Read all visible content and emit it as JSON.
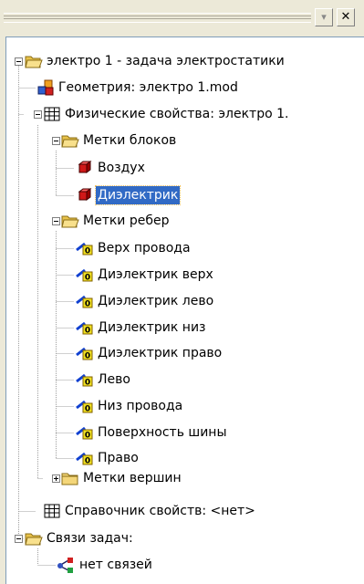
{
  "toolbar": {
    "dropdown_glyph": "▾",
    "close_glyph": "✕"
  },
  "colors": {
    "selection": "#316ac5",
    "folder": "#f4d679",
    "lines": "#a0a0a0"
  },
  "tree": {
    "root": {
      "label": "электро 1 - задача электростатики",
      "icon": "open-folder-icon"
    },
    "geometry": {
      "label": "Геометрия: электро 1.mod",
      "icon": "geometry-icon"
    },
    "props": {
      "label": "Физические свойства: электро 1.",
      "icon": "table-icon"
    },
    "block_labels": {
      "label": "Метки блоков",
      "icon": "open-folder-icon",
      "items": [
        {
          "label": "Воздух",
          "icon": "block-cube-icon"
        },
        {
          "label": "Диэлектрик",
          "icon": "block-cube-icon",
          "selected": true
        }
      ]
    },
    "edge_labels": {
      "label": "Метки ребер",
      "icon": "open-folder-icon",
      "items": [
        {
          "label": "Верх провода",
          "icon": "edge-icon"
        },
        {
          "label": "Диэлектрик верх",
          "icon": "edge-icon"
        },
        {
          "label": "Диэлектрик лево",
          "icon": "edge-icon"
        },
        {
          "label": "Диэлектрик низ",
          "icon": "edge-icon"
        },
        {
          "label": "Диэлектрик право",
          "icon": "edge-icon"
        },
        {
          "label": "Лево",
          "icon": "edge-icon"
        },
        {
          "label": "Низ провода",
          "icon": "edge-icon"
        },
        {
          "label": "Поверхность шины",
          "icon": "edge-icon"
        },
        {
          "label": "Право",
          "icon": "edge-icon"
        }
      ]
    },
    "vertex_labels": {
      "label": "Метки вершин",
      "icon": "closed-folder-icon"
    },
    "reference": {
      "label": "Справочник свойств: <нет>",
      "icon": "table-icon"
    },
    "links": {
      "label": "Связи задач:",
      "icon": "open-folder-icon",
      "items": [
        {
          "label": "нет связей",
          "icon": "link-icon"
        }
      ]
    }
  }
}
